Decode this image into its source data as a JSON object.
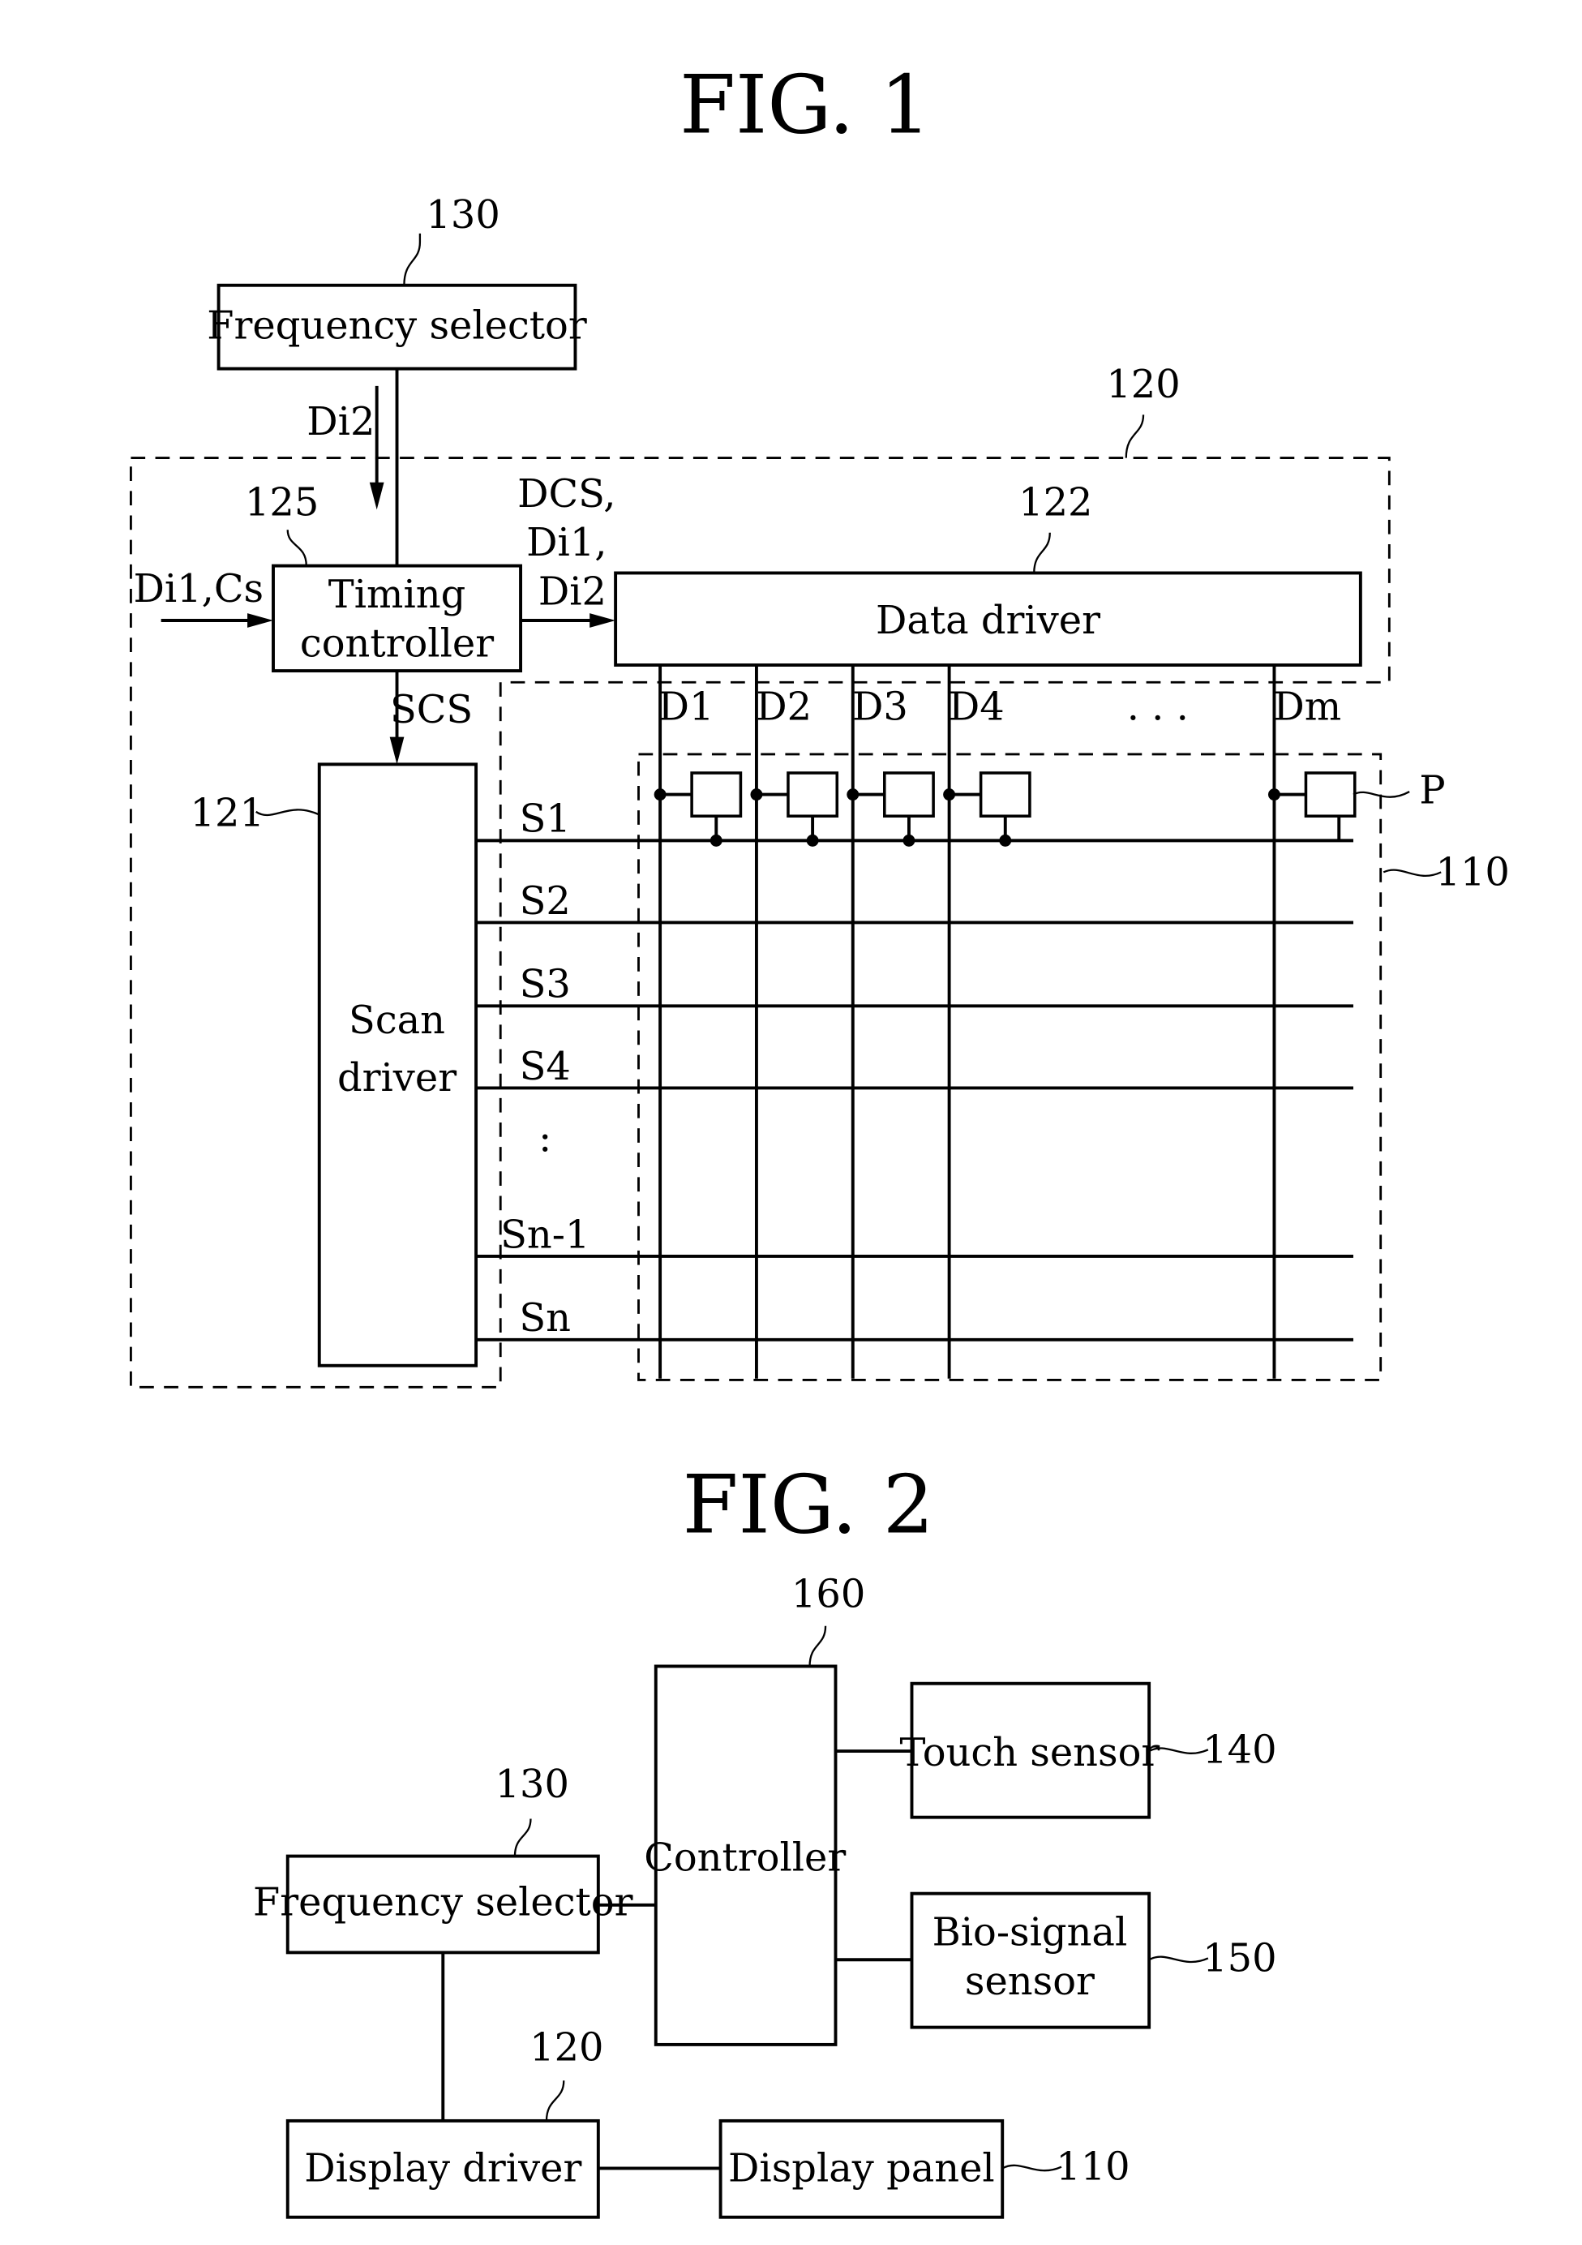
{
  "fig1": {
    "title": "FIG. 1",
    "frequency_selector": {
      "label": "Frequency selector",
      "ref": "130"
    },
    "display_driver_ref": "120",
    "timing_controller": {
      "label_line1": "Timing",
      "label_line2": "controller",
      "ref": "125"
    },
    "data_driver": {
      "label": "Data driver",
      "ref": "122"
    },
    "scan_driver": {
      "label_line1": "Scan",
      "label_line2": "driver",
      "ref": "121"
    },
    "panel_ref": "110",
    "pixel_label": "P",
    "signals": {
      "di2": "Di2",
      "input": "Di1,Cs",
      "dcs_line1": "DCS,",
      "dcs_line2": "Di1,",
      "dcs_line3": "Di2",
      "scs": "SCS"
    },
    "data_lines": [
      "D1",
      "D2",
      "D3",
      "D4",
      "Dm"
    ],
    "scan_lines": [
      "S1",
      "S2",
      "S3",
      "S4",
      "Sn-1",
      "Sn"
    ],
    "ellipsis_h": ". . .",
    "ellipsis_v": ":"
  },
  "fig2": {
    "title": "FIG. 2",
    "controller": {
      "label": "Controller",
      "ref": "160"
    },
    "touch_sensor": {
      "label": "Touch sensor",
      "ref": "140"
    },
    "bio_signal_sensor": {
      "label_line1": "Bio-signal",
      "label_line2": "sensor",
      "ref": "150"
    },
    "frequency_selector": {
      "label": "Frequency selector",
      "ref": "130"
    },
    "display_driver": {
      "label": "Display driver",
      "ref": "120"
    },
    "display_panel": {
      "label": "Display panel",
      "ref": "110"
    }
  }
}
